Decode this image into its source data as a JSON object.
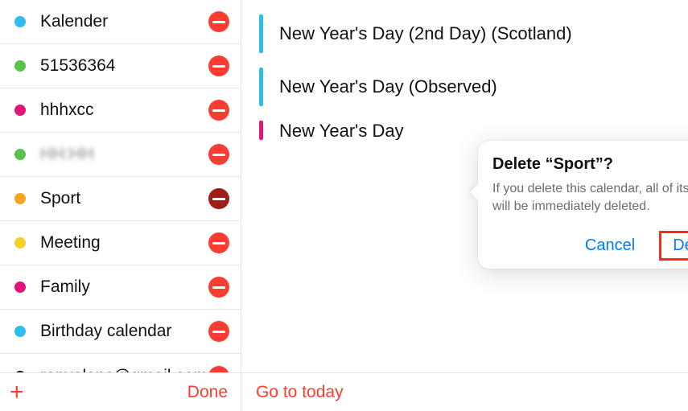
{
  "calendars": [
    {
      "name": "Kalender",
      "color": "#2fbdef"
    },
    {
      "name": "51536364",
      "color": "#5ac24b"
    },
    {
      "name": "hhhxcc",
      "color": "#e0147a"
    },
    {
      "name": "HH:HH",
      "color": "#5ac24b",
      "blurred": true
    },
    {
      "name": "Sport",
      "color": "#f5a523",
      "selected": true
    },
    {
      "name": "Meeting",
      "color": "#f6d027"
    },
    {
      "name": "Family",
      "color": "#e0147a"
    },
    {
      "name": "Birthday calendar",
      "color": "#2fbdef"
    },
    {
      "name": "ronvalans@gmail.com",
      "color": "#111111"
    }
  ],
  "events": [
    {
      "title": "New Year's Day (2nd Day) (Scotland)",
      "color": "blue"
    },
    {
      "title": "New Year's Day (Observed)",
      "color": "blue"
    },
    {
      "title": "New Year's Day",
      "color": "pink",
      "clipped": true
    }
  ],
  "dialog": {
    "title": "Delete “Sport”?",
    "message": "If you delete this calendar, all of its events will be immediately deleted.",
    "cancel": "Cancel",
    "confirm": "Delete"
  },
  "footer": {
    "done": "Done",
    "goto": "Go to today"
  }
}
